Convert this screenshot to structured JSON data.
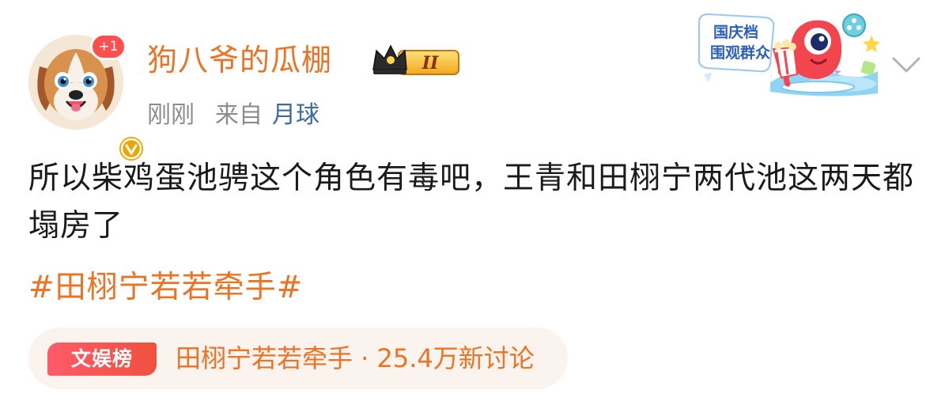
{
  "header": {
    "username": "狗八爷的瓜棚",
    "plus_badge": "+1",
    "vip_level": "II",
    "meta": {
      "time": "刚刚",
      "from_label": "来自",
      "source": "月球"
    },
    "promo": {
      "line1": "国庆档",
      "line2": "围观群众"
    }
  },
  "post": {
    "text": "所以柴鸡蛋池骋这个角色有毒吧，王青和田栩宁两代池这两天都塌房了",
    "hashtag": "#田栩宁若若牵手#"
  },
  "trend": {
    "tag": "文娱榜",
    "text": "田栩宁若若牵手 · 25.4万新讨论"
  },
  "colors": {
    "accent": "#eb7323",
    "link_blue": "#3c6aa3",
    "meta_gray": "#8c8c8c",
    "card_bg": "#fbf3ee",
    "tag_red": "#f0513d"
  },
  "icons": {
    "avatar": "dog-avatar",
    "verified": "verified-check-icon",
    "vip": "crown-vip-icon",
    "menu": "chevron-down-icon"
  }
}
